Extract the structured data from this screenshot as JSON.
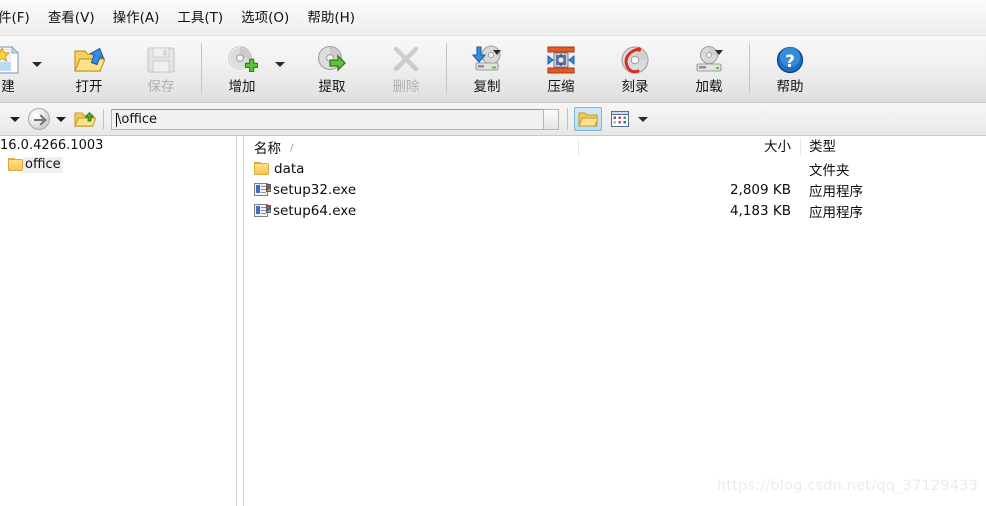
{
  "menubar": {
    "items": [
      {
        "label": "件(F)",
        "name": "menu-file"
      },
      {
        "label": "查看(V)",
        "name": "menu-view"
      },
      {
        "label": "操作(A)",
        "name": "menu-action"
      },
      {
        "label": "工具(T)",
        "name": "menu-tools"
      },
      {
        "label": "选项(O)",
        "name": "menu-options"
      },
      {
        "label": "帮助(H)",
        "name": "menu-help"
      }
    ]
  },
  "toolbar": {
    "new_label": "建",
    "open_label": "打开",
    "save_label": "保存",
    "add_label": "增加",
    "extract_label": "提取",
    "delete_label": "删除",
    "copy_label": "复制",
    "compress_label": "压缩",
    "burn_label": "刻录",
    "mount_label": "加载",
    "help_label": "帮助"
  },
  "addressbar": {
    "path_value": "\\office",
    "path_placeholder": "\\office"
  },
  "tree": {
    "root_label": "16.0.4266.1003",
    "items": [
      {
        "label": "office",
        "name": "tree-item-office"
      }
    ]
  },
  "list": {
    "columns": {
      "name": "名称",
      "size": "大小",
      "type": "类型",
      "sort_indicator": "/"
    },
    "rows": [
      {
        "name": "data",
        "size": "",
        "type": "文件夹",
        "icon": "folder-icon"
      },
      {
        "name": "setup32.exe",
        "size": "2,809 KB",
        "type": "应用程序",
        "icon": "application-icon"
      },
      {
        "name": "setup64.exe",
        "size": "4,183 KB",
        "type": "应用程序",
        "icon": "application-icon"
      }
    ]
  },
  "watermark": {
    "text": "https://blog.csdn.net/qq_37129433"
  },
  "colors": {
    "accent": "#3a6fc4",
    "folder": "#f6c752",
    "toolbar_top": "#f8f8f8",
    "toolbar_bottom": "#dcdcdc",
    "watermark": "#ebebeb"
  }
}
